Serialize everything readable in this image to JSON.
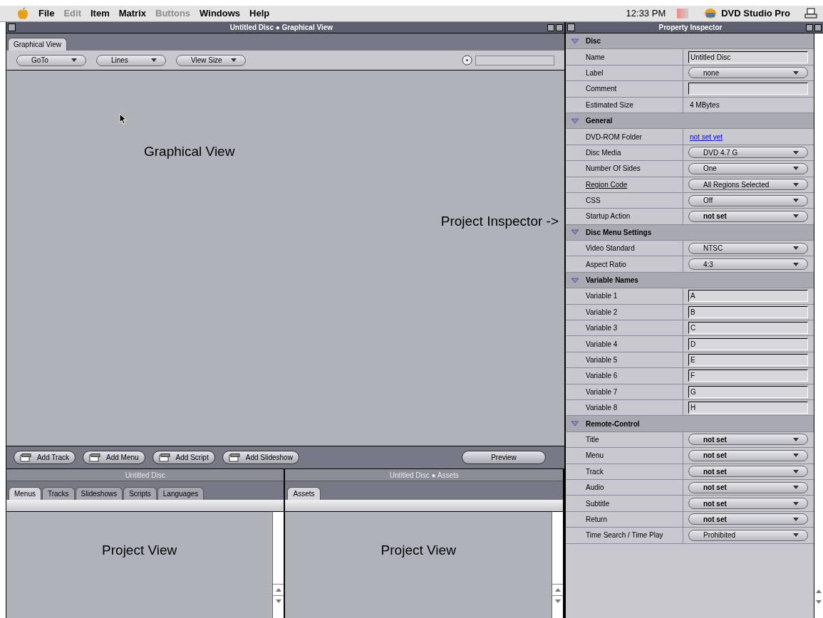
{
  "menubar": {
    "items": [
      {
        "label": "File",
        "disabled": false
      },
      {
        "label": "Edit",
        "disabled": true
      },
      {
        "label": "Item",
        "disabled": false
      },
      {
        "label": "Matrix",
        "disabled": false
      },
      {
        "label": "Buttons",
        "disabled": true
      },
      {
        "label": "Windows",
        "disabled": false
      },
      {
        "label": "Help",
        "disabled": false
      }
    ],
    "clock": "12:33 PM",
    "app_name": "DVD Studio Pro"
  },
  "graphical_window": {
    "title": "Untitled Disc ● Graphical View",
    "tabs": [
      {
        "label": "Graphical View",
        "selected": true
      }
    ],
    "dropdowns": [
      "GoTo",
      "Lines",
      "View Size"
    ],
    "annotations": [
      "Graphical View",
      "Project Inspector ->"
    ],
    "buttons": [
      "Add Track",
      "Add Menu",
      "Add Script",
      "Add Slideshow"
    ],
    "preview_button": "Preview"
  },
  "project_panes": [
    {
      "title": "Untitled Disc",
      "tabs": [
        {
          "label": "Menus",
          "selected": true
        },
        {
          "label": "Tracks",
          "selected": false
        },
        {
          "label": "Slideshows",
          "selected": false
        },
        {
          "label": "Scripts",
          "selected": false
        },
        {
          "label": "Languages",
          "selected": false
        }
      ],
      "annotation": "Project View"
    },
    {
      "title": "Untitled Disc ● Assets",
      "tabs": [
        {
          "label": "Assets",
          "selected": true
        }
      ],
      "annotation": "Project View"
    }
  ],
  "inspector": {
    "title": "Property Inspector",
    "sections": [
      {
        "title": "Disc",
        "expanded": true,
        "rows": [
          {
            "label": "Name",
            "kind": "field",
            "value": "Untitled Disc"
          },
          {
            "label": "Label",
            "kind": "select",
            "value": "none"
          },
          {
            "label": "Comment",
            "kind": "field"
          },
          {
            "label": "Estimated Size",
            "kind": "text",
            "value": "4 MBytes"
          }
        ]
      },
      {
        "title": "General",
        "expanded": true,
        "rows": [
          {
            "label": "DVD-ROM Folder",
            "kind": "link",
            "value": "not set yet"
          },
          {
            "label": "Disc Media",
            "kind": "select",
            "value": "DVD 4.7 G"
          },
          {
            "label": "Number Of Sides",
            "kind": "select",
            "value": "One"
          },
          {
            "label": "Region Code",
            "kind": "select",
            "value": "All Regions Selected",
            "underlined": true
          },
          {
            "label": "CSS",
            "kind": "select",
            "value": "Off"
          },
          {
            "label": "Startup Action",
            "kind": "select",
            "value": "not set",
            "bold": true
          }
        ]
      },
      {
        "title": "Disc Menu Settings",
        "expanded": true,
        "rows": [
          {
            "label": "Video Standard",
            "kind": "select",
            "value": "NTSC"
          },
          {
            "label": "Aspect Ratio",
            "kind": "select",
            "value": "4:3"
          }
        ]
      },
      {
        "title": "Variable Names",
        "expanded": true,
        "rows": [
          {
            "label": "Variable 1",
            "kind": "field",
            "value": "A"
          },
          {
            "label": "Variable 2",
            "kind": "field",
            "value": "B"
          },
          {
            "label": "Variable 3",
            "kind": "field",
            "value": "C"
          },
          {
            "label": "Variable 4",
            "kind": "field",
            "value": "D"
          },
          {
            "label": "Variable 5",
            "kind": "field",
            "value": "E"
          },
          {
            "label": "Variable 6",
            "kind": "field",
            "value": "F"
          },
          {
            "label": "Variable 7",
            "kind": "field",
            "value": "G"
          },
          {
            "label": "Variable 8",
            "kind": "field",
            "value": "H"
          }
        ]
      },
      {
        "title": "Remote-Control",
        "expanded": true,
        "rows": [
          {
            "label": "Title",
            "kind": "select",
            "value": "not set",
            "bold": true
          },
          {
            "label": "Menu",
            "kind": "select",
            "value": "not set",
            "bold": true
          },
          {
            "label": "Track",
            "kind": "select",
            "value": "not set",
            "bold": true
          },
          {
            "label": "Audio",
            "kind": "select",
            "value": "not set",
            "bold": true
          },
          {
            "label": "Subtitle",
            "kind": "select",
            "value": "not set",
            "bold": true
          },
          {
            "label": "Return",
            "kind": "select",
            "value": "not set",
            "bold": true
          },
          {
            "label": "Time Search / Time Play",
            "kind": "select",
            "value": "Prohibited"
          }
        ]
      }
    ]
  }
}
